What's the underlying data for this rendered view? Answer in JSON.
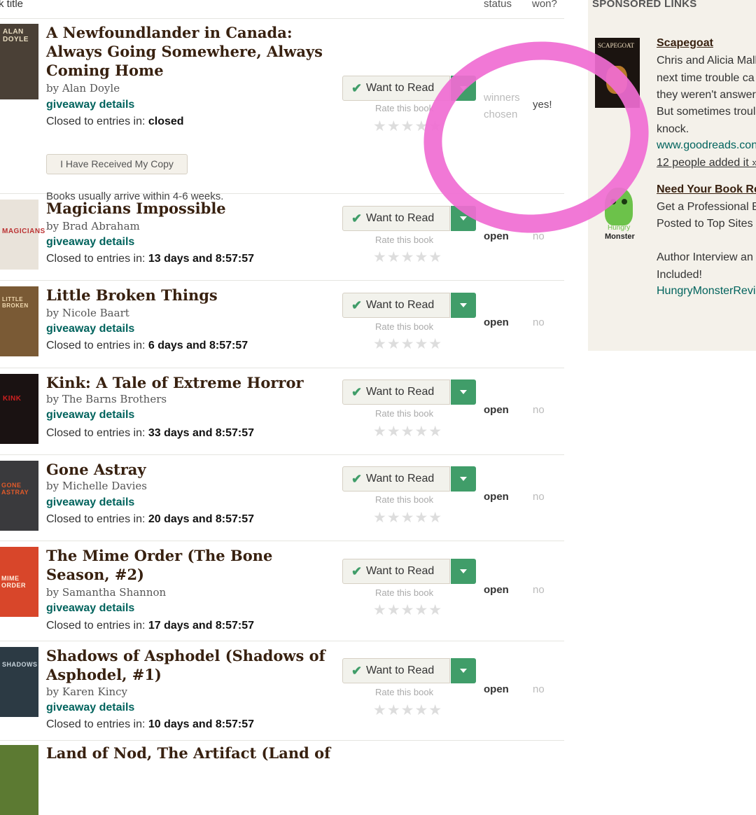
{
  "header": {
    "title_col": "k title",
    "status_col": "status",
    "won_col": "won?"
  },
  "sidebar": {
    "title": "SPONSORED LINKS",
    "ads": [
      {
        "heading": "Scapegoat",
        "lines": [
          "Chris and Alicia Mall",
          "next time trouble ca",
          "they weren't answer",
          "But sometimes troul",
          "knock."
        ],
        "link": "www.goodreads.con",
        "added": "12 people added it »",
        "cover_text": "SCAPEGOAT"
      },
      {
        "heading": "Need Your Book Rev",
        "lines": [
          "Get a Professional B",
          "Posted to Top Sites i",
          "",
          "Author Interview an",
          "Included!"
        ],
        "link": "HungryMonsterRevi",
        "logo_text": [
          "Hungry",
          "Monster"
        ]
      }
    ]
  },
  "common": {
    "want_to_read": "Want to Read",
    "rate": "Rate this book",
    "giveaway": "giveaway details",
    "closed_prefix": "Closed to entries in:",
    "by": "by"
  },
  "books": [
    {
      "title": "A Newfoundlander in Canada: Always Going Somewhere, Always Coming Home",
      "author": "Alan Doyle",
      "closed": "closed",
      "status": "winners chosen",
      "won": "yes!",
      "received": "I Have Received My Copy",
      "arrive": "Books usually arrive within 4-6 weeks.",
      "cover_text": "ALAN DOYLE",
      "cover_color": "#4a4036"
    },
    {
      "title": "Magicians Impossible",
      "author": "Brad Abraham",
      "closed": "13 days and 8:57:57",
      "status": "open",
      "won": "no",
      "cover_text": "MAGICIANS",
      "cover_color": "#e9e3da"
    },
    {
      "title": "Little Broken Things",
      "author": "Nicole Baart",
      "closed": "6 days and 8:57:57",
      "status": "open",
      "won": "no",
      "cover_text": "LITTLE BROKEN",
      "cover_color": "#7a5a35"
    },
    {
      "title": "Kink: A Tale of Extreme Horror",
      "author": "The Barns Brothers",
      "closed": "33 days and 8:57:57",
      "status": "open",
      "won": "no",
      "cover_text": "KINK",
      "cover_color": "#1a1212"
    },
    {
      "title": "Gone Astray",
      "author": "Michelle Davies",
      "closed": "20 days and 8:57:57",
      "status": "open",
      "won": "no",
      "cover_text": "GONE ASTRAY",
      "cover_color": "#3a3a3d"
    },
    {
      "title": "The Mime Order (The Bone Season, #2)",
      "author": "Samantha Shannon",
      "closed": "17 days and 8:57:57",
      "status": "open",
      "won": "no",
      "cover_text": "MIME ORDER",
      "cover_color": "#d8462a"
    },
    {
      "title": "Shadows of Asphodel (Shadows of Asphodel, #1)",
      "author": "Karen Kincy",
      "closed": "10 days and 8:57:57",
      "status": "open",
      "won": "no",
      "cover_text": "SHADOWS",
      "cover_color": "#2c3a44"
    },
    {
      "title": "Land of Nod, The Artifact (Land of",
      "author": "",
      "closed": "",
      "status": "",
      "won": "",
      "cover_text": "",
      "cover_color": "#5c7a32"
    }
  ]
}
